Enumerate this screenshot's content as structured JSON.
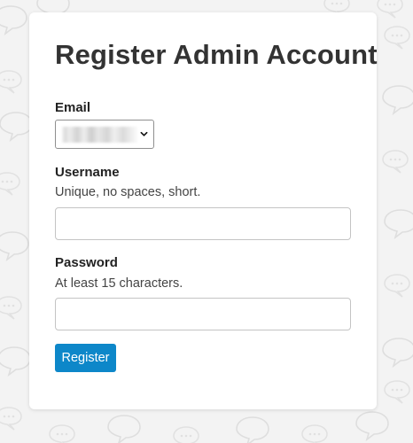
{
  "page": {
    "title": "Register Admin Account"
  },
  "email": {
    "label": "Email",
    "selected_value": "██████████"
  },
  "username": {
    "label": "Username",
    "hint": "Unique, no spaces, short.",
    "value": ""
  },
  "password": {
    "label": "Password",
    "hint": "At least 15 characters.",
    "value": ""
  },
  "register_button": {
    "label": "Register"
  },
  "colors": {
    "background": "#f3f3f3",
    "card": "#ffffff",
    "accent": "#0d87c9",
    "text": "#333333"
  },
  "icons": {
    "select_caret": "chevron-down-icon",
    "background": "speech-bubble-pattern"
  }
}
